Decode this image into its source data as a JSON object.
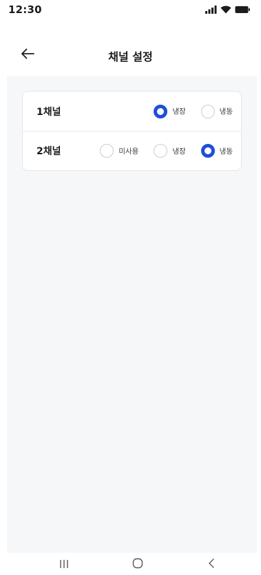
{
  "status_bar": {
    "time": "12:30",
    "icons": [
      "signal-icon",
      "wifi-icon",
      "battery-icon"
    ]
  },
  "header": {
    "title": "채널 설정",
    "back_icon": "arrow-left-icon"
  },
  "channels": [
    {
      "label": "1채널",
      "options": [
        {
          "label": "냉장",
          "checked": true
        },
        {
          "label": "냉동",
          "checked": false
        }
      ]
    },
    {
      "label": "2채널",
      "options": [
        {
          "label": "미사용",
          "checked": false
        },
        {
          "label": "냉장",
          "checked": false
        },
        {
          "label": "냉동",
          "checked": true
        }
      ]
    }
  ],
  "nav_bar": {
    "icons": [
      "recent-apps-icon",
      "home-icon",
      "back-icon"
    ]
  },
  "colors": {
    "accent": "#1d4fd8",
    "content_background": "#f6f7f9"
  }
}
